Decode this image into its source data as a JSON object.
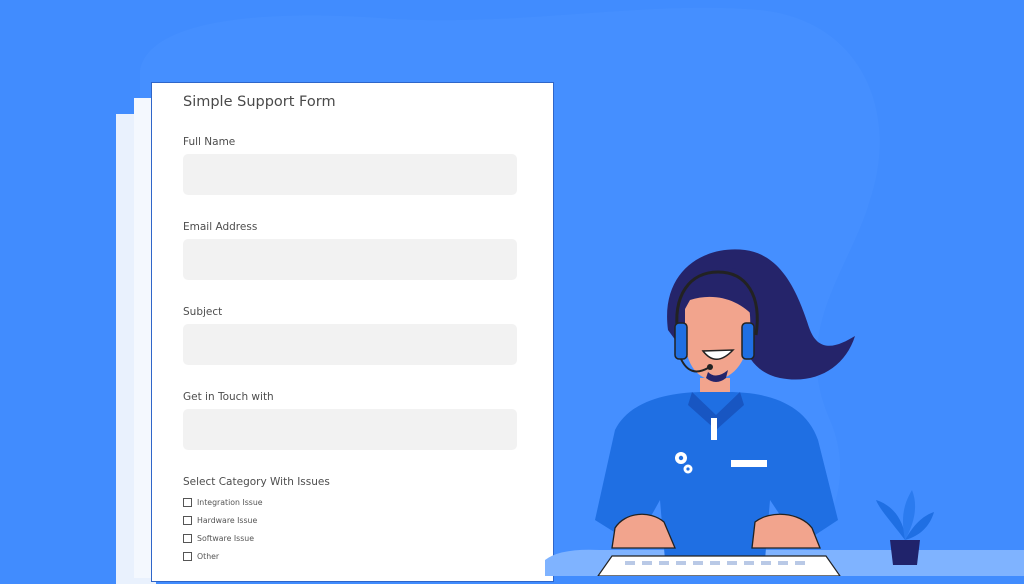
{
  "form": {
    "title": "Simple Support Form",
    "fields": [
      {
        "label": "Full Name",
        "value": ""
      },
      {
        "label": "Email Address",
        "value": ""
      },
      {
        "label": "Subject",
        "value": ""
      },
      {
        "label": "Get in Touch with",
        "value": ""
      }
    ],
    "category": {
      "label": "Select Category With Issues",
      "options": [
        {
          "label": "Integration Issue",
          "checked": false
        },
        {
          "label": "Hardware Issue",
          "checked": false
        },
        {
          "label": "Software Issue",
          "checked": false
        },
        {
          "label": "Other",
          "checked": false
        }
      ]
    }
  },
  "colors": {
    "background": "#418cfe",
    "shirt": "#1f6fe3",
    "hair": "#25246a",
    "skin": "#f2a48d"
  }
}
